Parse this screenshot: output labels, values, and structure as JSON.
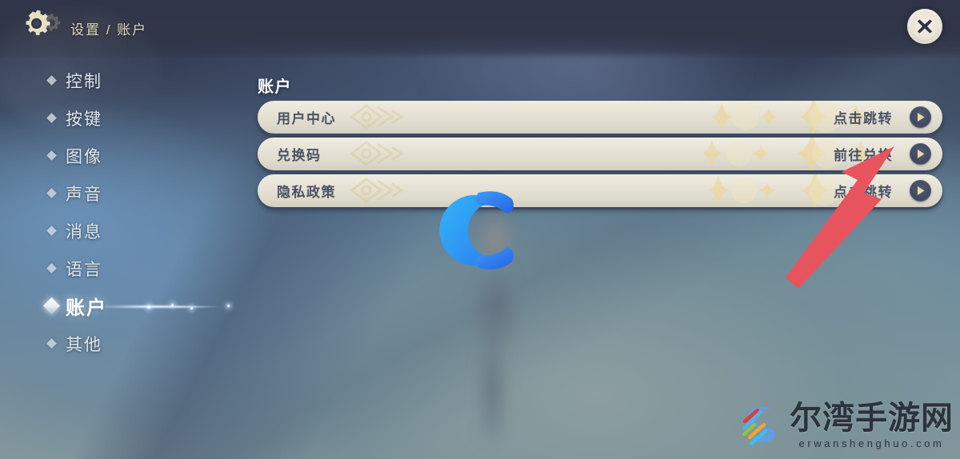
{
  "header": {
    "gear_icon": "gear-icon",
    "breadcrumb": "设置 / 账户",
    "close_icon": "close-icon"
  },
  "sidebar": {
    "items": [
      {
        "label": "控制",
        "active": false
      },
      {
        "label": "按键",
        "active": false
      },
      {
        "label": "图像",
        "active": false
      },
      {
        "label": "声音",
        "active": false
      },
      {
        "label": "消息",
        "active": false
      },
      {
        "label": "语言",
        "active": false
      },
      {
        "label": "账户",
        "active": true
      },
      {
        "label": "其他",
        "active": false
      }
    ]
  },
  "main": {
    "title": "账户",
    "rows": [
      {
        "label": "用户中心",
        "action": "点击跳转",
        "arrow_icon": "chevron-right-icon"
      },
      {
        "label": "兑换码",
        "action": "前往兑换",
        "arrow_icon": "chevron-right-icon"
      },
      {
        "label": "隐私政策",
        "action": "点击跳转",
        "arrow_icon": "chevron-right-icon"
      }
    ]
  },
  "overlays": {
    "center_logo": "letter-c-logo",
    "annotation_arrow": "red-arrow-annotation",
    "watermark": {
      "title": "尔湾手游网",
      "subtitle": "erwanshenghuo.com",
      "mark": "colorful-s-logo"
    }
  },
  "colors": {
    "header_band": "#313648",
    "breadcrumb_text": "#e2d9bd",
    "sidebar_text": "#dfe5e9",
    "sidebar_active_text": "#ffffff",
    "row_fill": "#e6e2d5",
    "row_shadow": "#3e4a63",
    "row_text": "#4a5266",
    "arrow_circle": "#434c63",
    "arrow_glyph": "#e8d9a4",
    "annotation_red": "#e8545e",
    "logo_blue": "#2f8ef4"
  }
}
